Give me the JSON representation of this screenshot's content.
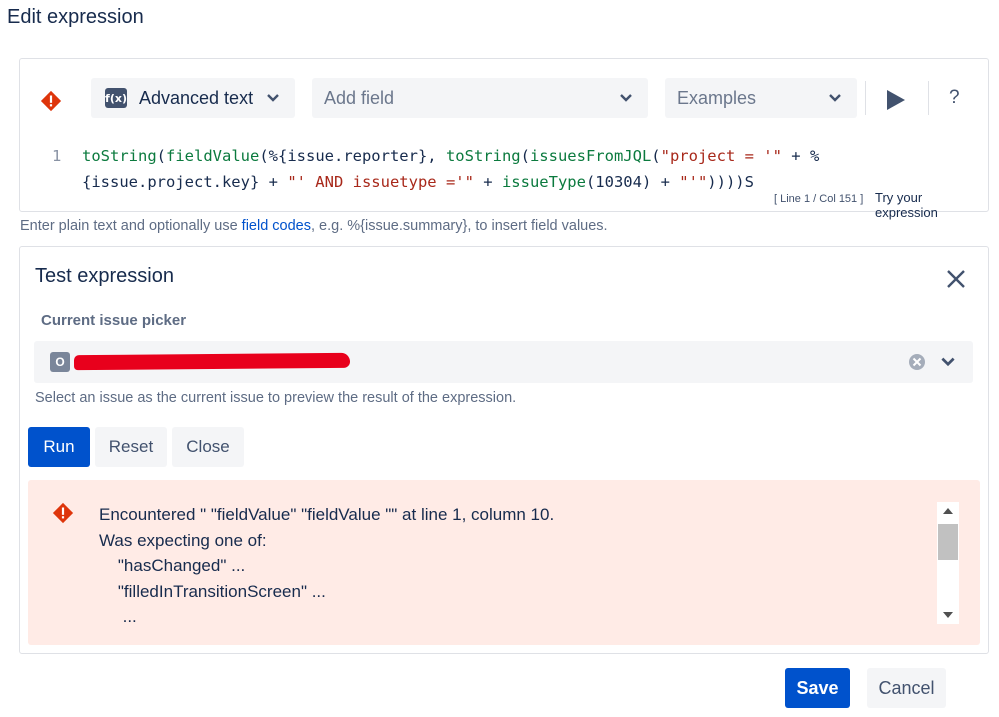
{
  "dialog": {
    "title": "Edit expression"
  },
  "toolbar": {
    "mode_label": "Advanced text",
    "mode_icon": "f(x)",
    "add_field_placeholder": "Add field",
    "examples_placeholder": "Examples",
    "help_label": "?"
  },
  "editor": {
    "line_number": "1",
    "line1_parts": [
      "toString",
      "(",
      "fieldValue",
      "(%{issue.reporter}, ",
      "toString",
      "(",
      "issuesFromJQL",
      "(",
      "\"project = '\"",
      " + %"
    ],
    "line2_parts": [
      "{issue.project.key} + ",
      "\"' AND issuetype ='\"",
      " + ",
      "issueType",
      "(10304) + ",
      "\"'\"",
      "))))S"
    ],
    "cursor_info": "[ Line 1 / Col 151 ]",
    "try_label": "Try your expression"
  },
  "hint": {
    "before": "Enter plain text and optionally use ",
    "link": "field codes",
    "after": ", e.g. %{issue.summary}, to insert field values."
  },
  "test": {
    "title": "Test expression",
    "picker_label": "Current issue picker",
    "picker_icon": "O",
    "picker_hint": "Select an issue as the current issue to preview the result of the expression.",
    "run_label": "Run",
    "reset_label": "Reset",
    "close_label": "Close"
  },
  "error": {
    "lines": [
      "Encountered \" \"fieldValue\" \"fieldValue \"\" at line 1, column 10.",
      "Was expecting one of:",
      "    \"hasChanged\" ...",
      "    \"filledInTransitionScreen\" ...",
      "     ..."
    ]
  },
  "footer": {
    "save_label": "Save",
    "cancel_label": "Cancel"
  },
  "colors": {
    "primary": "#0052cc",
    "error": "#de350b",
    "error_bg": "#ffebe6"
  }
}
